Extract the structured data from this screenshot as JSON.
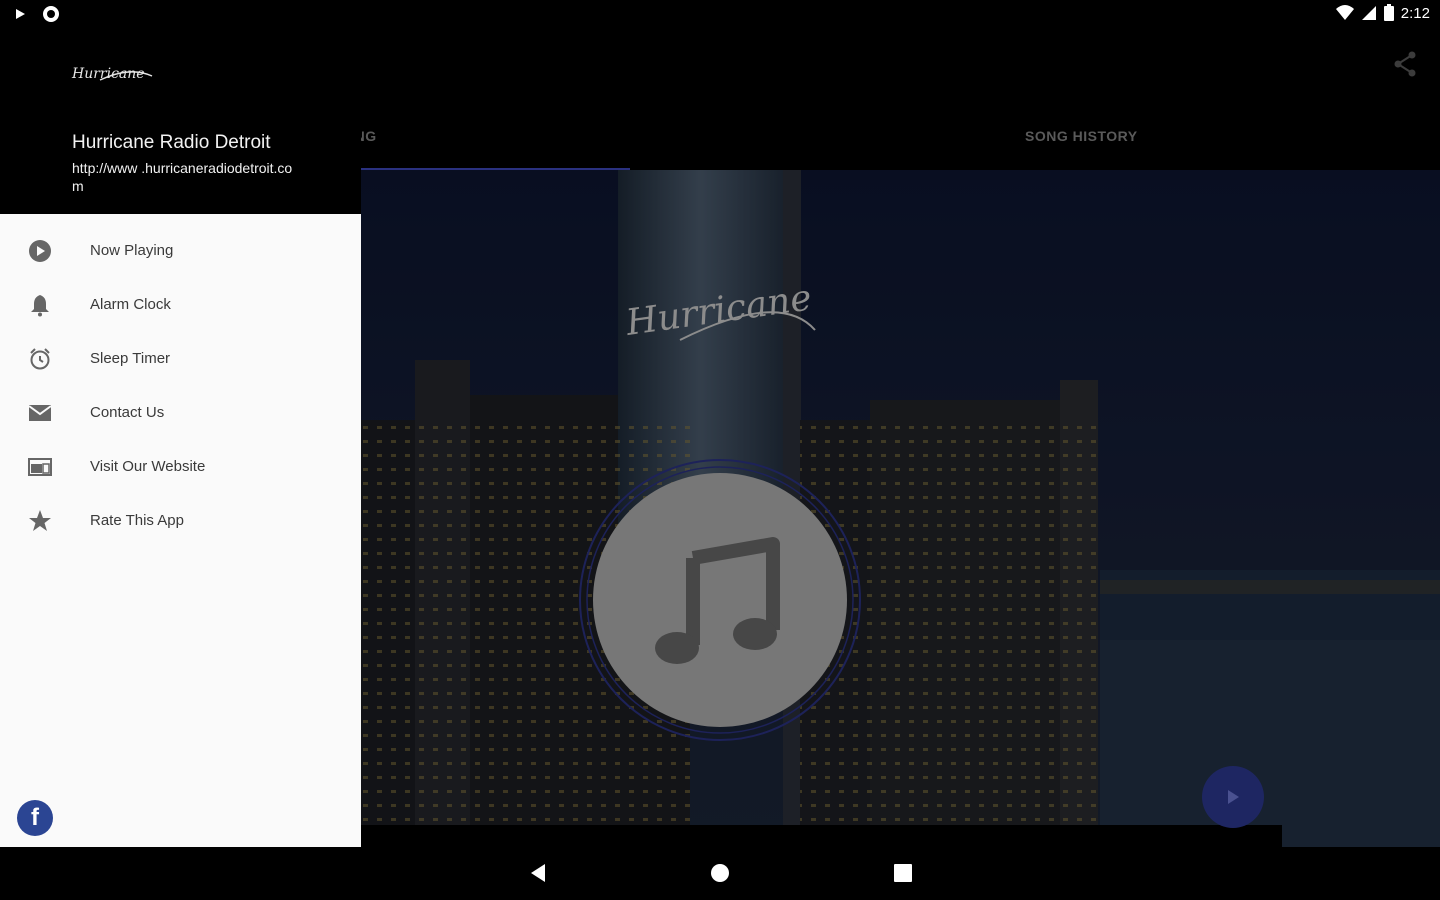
{
  "status_bar": {
    "time": "2:12",
    "icons": [
      "play-icon",
      "record-icon",
      "wifi-icon",
      "signal-icon",
      "battery-icon"
    ]
  },
  "app_bar": {
    "share_icon": "share-icon"
  },
  "tabs": [
    {
      "label": "LAYING",
      "active": true
    },
    {
      "label": "SONG HISTORY",
      "active": false
    }
  ],
  "hero": {
    "sign_text": "Hurricane",
    "album_art_icon": "music-note-icon"
  },
  "drawer": {
    "station_name": "Hurricane Radio Detroit",
    "station_url": "http://www .hurricaneradiodetroit.com",
    "logo_text": "Hurricane",
    "items": [
      {
        "label": "Now Playing",
        "icon": "play-circle-icon"
      },
      {
        "label": "Alarm Clock",
        "icon": "bell-icon"
      },
      {
        "label": "Sleep Timer",
        "icon": "alarm-clock-icon"
      },
      {
        "label": "Contact Us",
        "icon": "mail-icon"
      },
      {
        "label": "Visit Our Website",
        "icon": "web-icon"
      },
      {
        "label": "Rate This App",
        "icon": "star-icon"
      }
    ],
    "facebook_letter": "f"
  },
  "nav_bar": {
    "icons": [
      "back-icon",
      "home-icon",
      "recents-icon"
    ]
  },
  "colors": {
    "accent": "#1e2662",
    "drawer_bg": "#fafafa",
    "facebook": "#2b4593"
  }
}
